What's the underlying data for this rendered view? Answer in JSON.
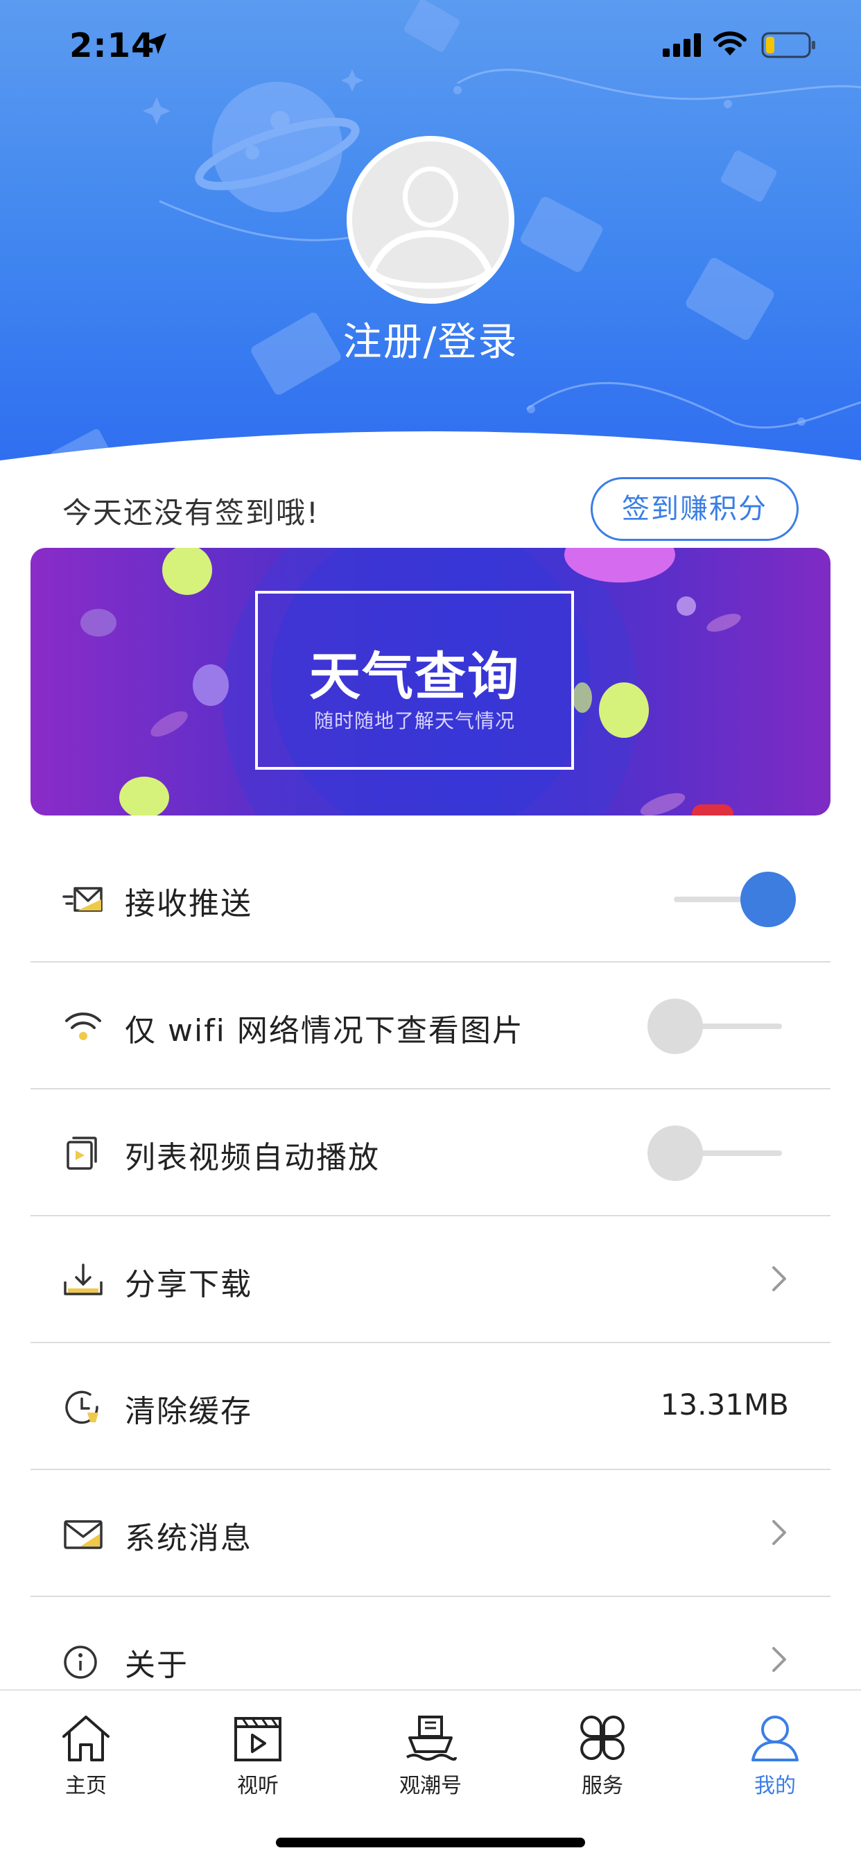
{
  "status_bar": {
    "time": "2:14",
    "icons": [
      "location-arrow-icon",
      "signal-icon",
      "wifi-icon",
      "battery-icon"
    ]
  },
  "header": {
    "avatar_icon": "default-avatar-icon",
    "login_label": "注册/登录"
  },
  "signin": {
    "message": "今天还没有签到哦!",
    "button_label": "签到赚积分"
  },
  "banner": {
    "title": "天气查询",
    "subtitle": "随时随地了解天气情况"
  },
  "settings": {
    "items": [
      {
        "icon": "push-envelope-icon",
        "label": "接收推送",
        "control": "toggle",
        "on": true
      },
      {
        "icon": "wifi-icon",
        "label": "仅 wifi 网络情况下查看图片",
        "control": "toggle",
        "on": false
      },
      {
        "icon": "video-play-icon",
        "label": "列表视频自动播放",
        "control": "toggle",
        "on": false
      },
      {
        "icon": "download-icon",
        "label": "分享下载",
        "control": "chevron"
      },
      {
        "icon": "clear-cache-icon",
        "label": "清除缓存",
        "control": "value",
        "value": "13.31MB"
      },
      {
        "icon": "mail-icon",
        "label": "系统消息",
        "control": "chevron"
      },
      {
        "icon": "info-icon",
        "label": "关于",
        "control": "chevron"
      }
    ]
  },
  "tabbar": {
    "tabs": [
      {
        "icon": "home-icon",
        "label": "主页",
        "active": false
      },
      {
        "icon": "clapperboard-icon",
        "label": "视听",
        "active": false
      },
      {
        "icon": "ship-icon",
        "label": "观潮号",
        "active": false
      },
      {
        "icon": "services-grid-icon",
        "label": "服务",
        "active": false
      },
      {
        "icon": "user-icon",
        "label": "我的",
        "active": true
      }
    ]
  },
  "colors": {
    "accent": "#3a7ee6",
    "header_top": "#5b9bf0",
    "header_bottom": "#2f6df0",
    "toggle_on": "#3c7ddf",
    "toggle_off": "#dcdcdc"
  }
}
